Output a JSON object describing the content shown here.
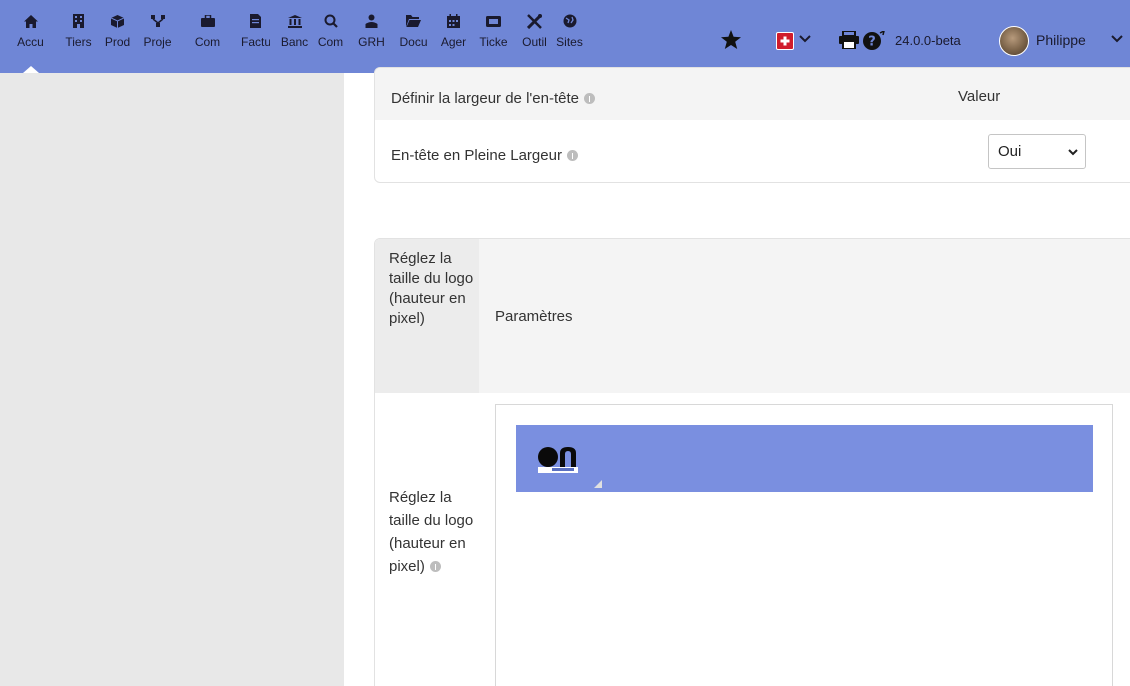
{
  "topbar": {
    "menu": [
      {
        "label": "Accu",
        "icon": "home-icon",
        "active": true
      },
      {
        "label": "Tiers",
        "icon": "building-icon"
      },
      {
        "label": "Prod",
        "icon": "cube-icon"
      },
      {
        "label": "Proje",
        "icon": "project-icon"
      },
      {
        "label": "Com",
        "icon": "suitcase-icon"
      },
      {
        "label": "Factu",
        "icon": "invoice-icon"
      },
      {
        "label": "Banc",
        "icon": "bank-icon"
      },
      {
        "label": "Com",
        "icon": "search-dollar-icon"
      },
      {
        "label": "GRH",
        "icon": "users-icon"
      },
      {
        "label": "Docu",
        "icon": "folder-icon"
      },
      {
        "label": "Ager",
        "icon": "calendar-icon"
      },
      {
        "label": "Ticke",
        "icon": "ticket-icon"
      },
      {
        "label": "Outil",
        "icon": "tools-icon"
      },
      {
        "label": "Sites",
        "icon": "globe-icon"
      }
    ],
    "version": "24.0.0-beta",
    "username": "Philippe"
  },
  "colors": {
    "topbar": "#6f86d6",
    "sidebar": "#e8e8e8",
    "logo_bar": "#7a8fe0"
  },
  "card1": {
    "header_label": "Définir la largeur de l'en-tête",
    "header_value_label": "Valeur",
    "row_label": "En-tête en Pleine Largeur",
    "row_value": "Oui"
  },
  "card2": {
    "header_col1": "Réglez la taille du logo (hauteur en pixel)",
    "header_col2": "Paramètres",
    "row_label": "Réglez la taille du logo (hauteur en pixel)"
  }
}
